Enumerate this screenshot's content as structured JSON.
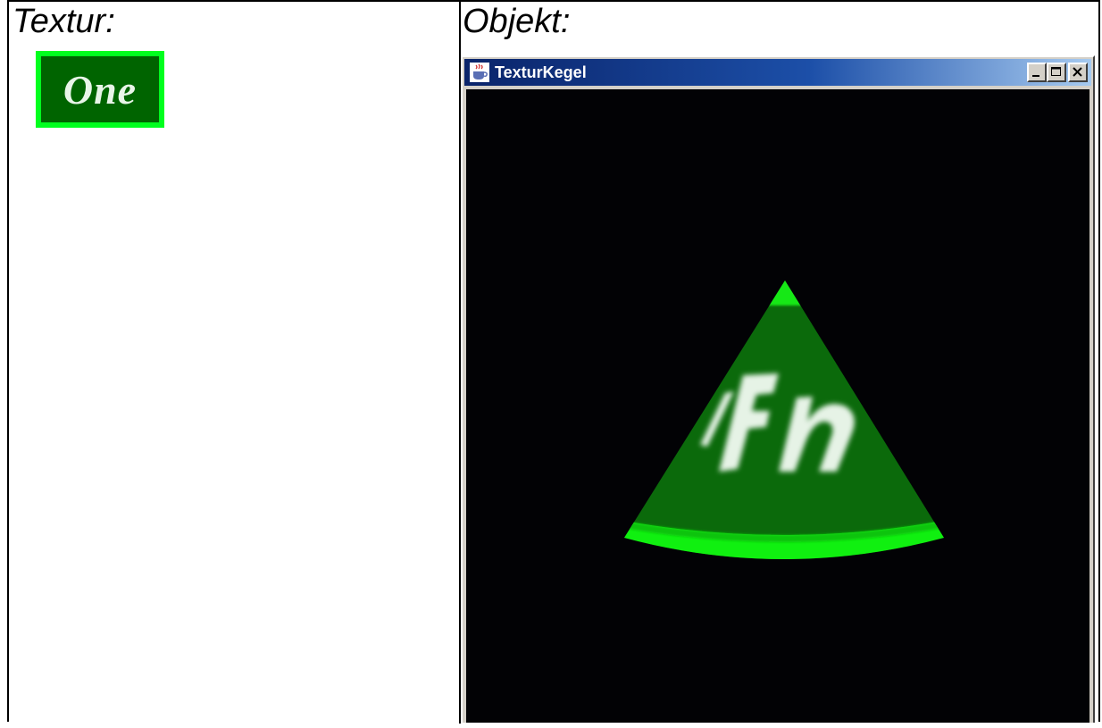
{
  "left_panel": {
    "heading": "Textur:",
    "texture_label": "One"
  },
  "right_panel": {
    "heading": "Objekt:",
    "window": {
      "title": "TexturKegel",
      "buttons": [
        "minimize",
        "maximize",
        "close"
      ],
      "icon": "java-cup-icon"
    }
  },
  "colors": {
    "texture_green": "#006400",
    "texture_border": "#00ff1e",
    "canvas_bg": "#020205",
    "titlebar_start": "#0a246a",
    "titlebar_end": "#a6caf0"
  }
}
